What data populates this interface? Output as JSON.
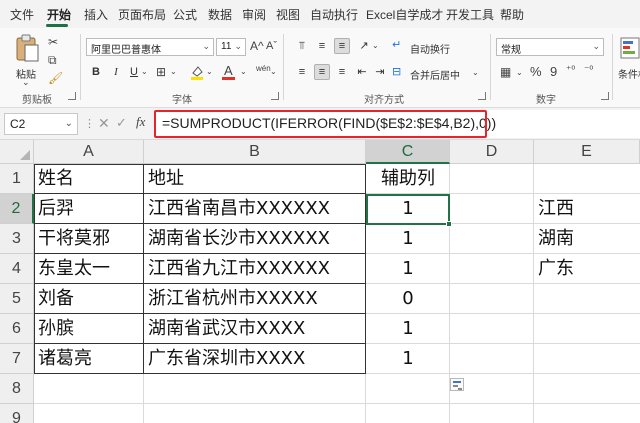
{
  "menu": {
    "tabs": [
      "文件",
      "开始",
      "插入",
      "页面布局",
      "公式",
      "数据",
      "审阅",
      "视图",
      "自动执行",
      "Excel自学成才",
      "开发工具",
      "帮助"
    ],
    "active_tab": "开始"
  },
  "ribbon": {
    "clipboard": {
      "paste_label": "粘贴",
      "group_label": "剪贴板"
    },
    "font": {
      "font_name": "阿里巴巴普惠体",
      "font_size": "11",
      "bold": "B",
      "italic": "I",
      "underline": "U",
      "font_color_icon": "A",
      "phonetic_icon": "wén",
      "grow_icon": "A^",
      "shrink_icon": "Aˇ",
      "group_label": "字体"
    },
    "alignment": {
      "wrap_label": "自动换行",
      "merge_label": "合并后居中",
      "group_label": "对齐方式"
    },
    "number": {
      "format": "常规",
      "percent": "%",
      "comma": "9",
      "group_label": "数字"
    },
    "styles": {
      "cond_format_label": "条件格"
    }
  },
  "formula_bar": {
    "name_box": "C2",
    "fx_label": "fx",
    "formula": "=SUMPRODUCT(IFERROR(FIND($E$2:$E$4,B2),0))"
  },
  "sheet": {
    "columns": [
      "A",
      "B",
      "C",
      "D",
      "E"
    ],
    "selected_column": "C",
    "rows": [
      "1",
      "2",
      "3",
      "4",
      "5",
      "6",
      "7",
      "8",
      "9"
    ],
    "selected_row": "2",
    "cells": {
      "A1": "姓名",
      "B1": "地址",
      "C1": "辅助列",
      "A2": "后羿",
      "B2": "江西省南昌市XXXXXX",
      "C2": "1",
      "E2": "江西",
      "A3": "干将莫邪",
      "B3": "湖南省长沙市XXXXXX",
      "C3": "1",
      "E3": "湖南",
      "A4": "东皇太一",
      "B4": "江西省九江市XXXXXX",
      "C4": "1",
      "E4": "广东",
      "A5": "刘备",
      "B5": "浙江省杭州市XXXXX",
      "C5": "0",
      "A6": "孙膑",
      "B6": "湖南省武汉市XXXX",
      "C6": "1",
      "A7": "诸葛亮",
      "B7": "广东省深圳市XXXX",
      "C7": "1"
    }
  },
  "colors": {
    "accent": "#217346",
    "highlight": "#e8232a"
  }
}
